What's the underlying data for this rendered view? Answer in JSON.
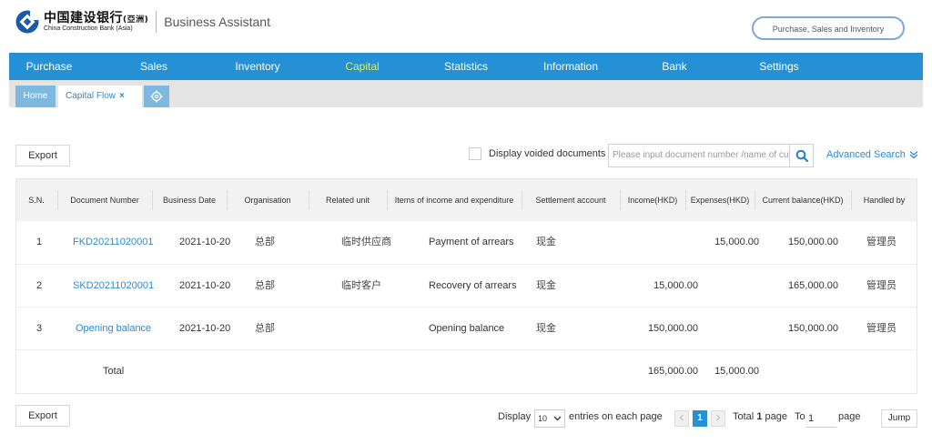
{
  "brand": {
    "name_cn": "中国建设银行",
    "name_cn_suffix": "(亞洲)",
    "name_en": "China Construction Bank (Asia)",
    "app_title": "Business Assistant",
    "color": "#1a5aa8"
  },
  "module_pill": "Purchase, Sales and Inventory",
  "nav": {
    "items": [
      "Purchase",
      "Sales",
      "Inventory",
      "Capital",
      "Statistics",
      "Information",
      "Bank",
      "Settings"
    ],
    "active": "Capital",
    "bg_color": "#2590d4",
    "active_color": "#e6ef4d"
  },
  "tabs": {
    "home": "Home",
    "current": "Capital Flow",
    "close": "×",
    "gear_icon": "gear-icon"
  },
  "toolbar": {
    "export_label": "Export",
    "voided_label": "Display voided documents",
    "search_placeholder": "Please input document number /name of cu",
    "advanced_search": "Advanced Search"
  },
  "table": {
    "headers": [
      "S.N.",
      "Document Number",
      "Business Date",
      "Organisation",
      "Related unit",
      "Items of income and expenditure",
      "Settlement account",
      "Income(HKD)",
      "Expenses(HKD)",
      "Current balance(HKD)",
      "Handled by"
    ],
    "rows": [
      {
        "sn": "1",
        "doc": "FKD20211020001",
        "date": "2021-10-20",
        "org": "总部",
        "unit": "临时供应商",
        "item": "Payment of arrears",
        "account": "现金",
        "income": "",
        "expenses": "15,000.00",
        "balance": "150,000.00",
        "handler": "管理员"
      },
      {
        "sn": "2",
        "doc": "SKD20211020001",
        "date": "2021-10-20",
        "org": "总部",
        "unit": "临时客户",
        "item": "Recovery of arrears",
        "account": "现金",
        "income": "15,000.00",
        "expenses": "",
        "balance": "165,000.00",
        "handler": "管理员"
      },
      {
        "sn": "3",
        "doc": "Opening balance",
        "date": "2021-10-20",
        "org": "总部",
        "unit": "",
        "item": "Opening balance",
        "account": "现金",
        "income": "150,000.00",
        "expenses": "",
        "balance": "150,000.00",
        "handler": "管理员"
      }
    ],
    "total": {
      "label": "Total",
      "income": "165,000.00",
      "expenses": "15,000.00"
    }
  },
  "pagination": {
    "display_label": "Display",
    "page_size": "10",
    "entries_label": "entries on each page",
    "current_page": "1",
    "total_prefix": "Total",
    "total_pages": "1",
    "total_suffix": "page",
    "to_label": "To",
    "goto_value": "1",
    "page_label": "page",
    "jump_label": "Jump"
  }
}
